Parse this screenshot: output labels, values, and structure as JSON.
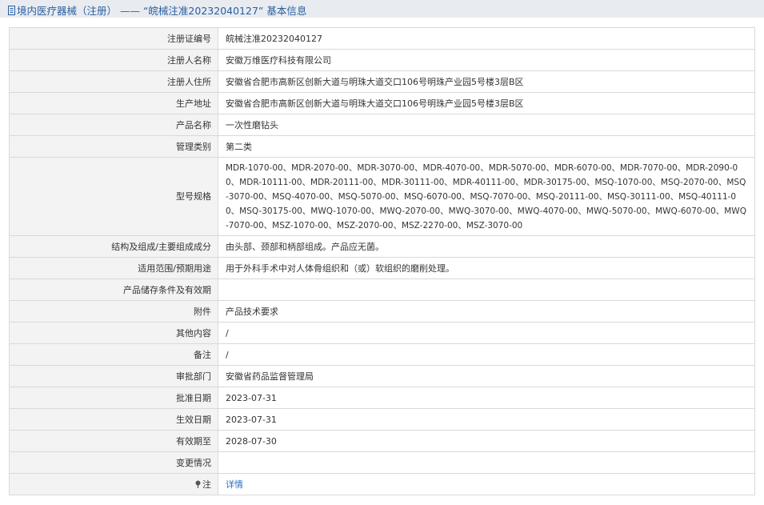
{
  "header": {
    "title": "境内医疗器械（注册） —— “皖械注准20232040127” 基本信息"
  },
  "rows": [
    {
      "label": "注册证编号",
      "value": "皖械注准20232040127"
    },
    {
      "label": "注册人名称",
      "value": "安徽万维医疗科技有限公司"
    },
    {
      "label": "注册人住所",
      "value": "安徽省合肥市高新区创新大道与明珠大道交口106号明珠产业园5号楼3层B区"
    },
    {
      "label": "生产地址",
      "value": "安徽省合肥市高新区创新大道与明珠大道交口106号明珠产业园5号楼3层B区"
    },
    {
      "label": "产品名称",
      "value": "一次性磨钻头"
    },
    {
      "label": "管理类别",
      "value": "第二类"
    },
    {
      "label": "型号规格",
      "value": "MDR-1070-00、MDR-2070-00、MDR-3070-00、MDR-4070-00、MDR-5070-00、MDR-6070-00、MDR-7070-00、MDR-2090-00、MDR-10111-00、MDR-20111-00、MDR-30111-00、MDR-40111-00、MDR-30175-00、MSQ-1070-00、MSQ-2070-00、MSQ-3070-00、MSQ-4070-00、MSQ-5070-00、MSQ-6070-00、MSQ-7070-00、MSQ-20111-00、MSQ-30111-00、MSQ-40111-00、MSQ-30175-00、MWQ-1070-00、MWQ-2070-00、MWQ-3070-00、MWQ-4070-00、MWQ-5070-00、MWQ-6070-00、MWQ-7070-00、MSZ-1070-00、MSZ-2070-00、MSZ-2270-00、MSZ-3070-00"
    },
    {
      "label": "结构及组成/主要组成成分",
      "value": "由头部、颈部和柄部组成。产品应无菌。"
    },
    {
      "label": "适用范围/预期用途",
      "value": "用于外科手术中对人体骨组织和（或）软组织的磨削处理。"
    },
    {
      "label": "产品储存条件及有效期",
      "value": ""
    },
    {
      "label": "附件",
      "value": "产品技术要求"
    },
    {
      "label": "其他内容",
      "value": "/"
    },
    {
      "label": "备注",
      "value": "/"
    },
    {
      "label": "审批部门",
      "value": "安徽省药品监督管理局"
    },
    {
      "label": "批准日期",
      "value": "2023-07-31"
    },
    {
      "label": "生效日期",
      "value": "2023-07-31"
    },
    {
      "label": "有效期至",
      "value": "2028-07-30"
    },
    {
      "label": "变更情况",
      "value": ""
    },
    {
      "label": "注",
      "value": "详情"
    }
  ],
  "colors": {
    "title": "#2a5d9f",
    "title_bar_bg": "#e8ecf1",
    "label_bg": "#f3f3f3",
    "border": "#d9d9d9",
    "link": "#2a6ebb"
  },
  "icons": {
    "title": "document-icon",
    "note": "pin-icon"
  }
}
